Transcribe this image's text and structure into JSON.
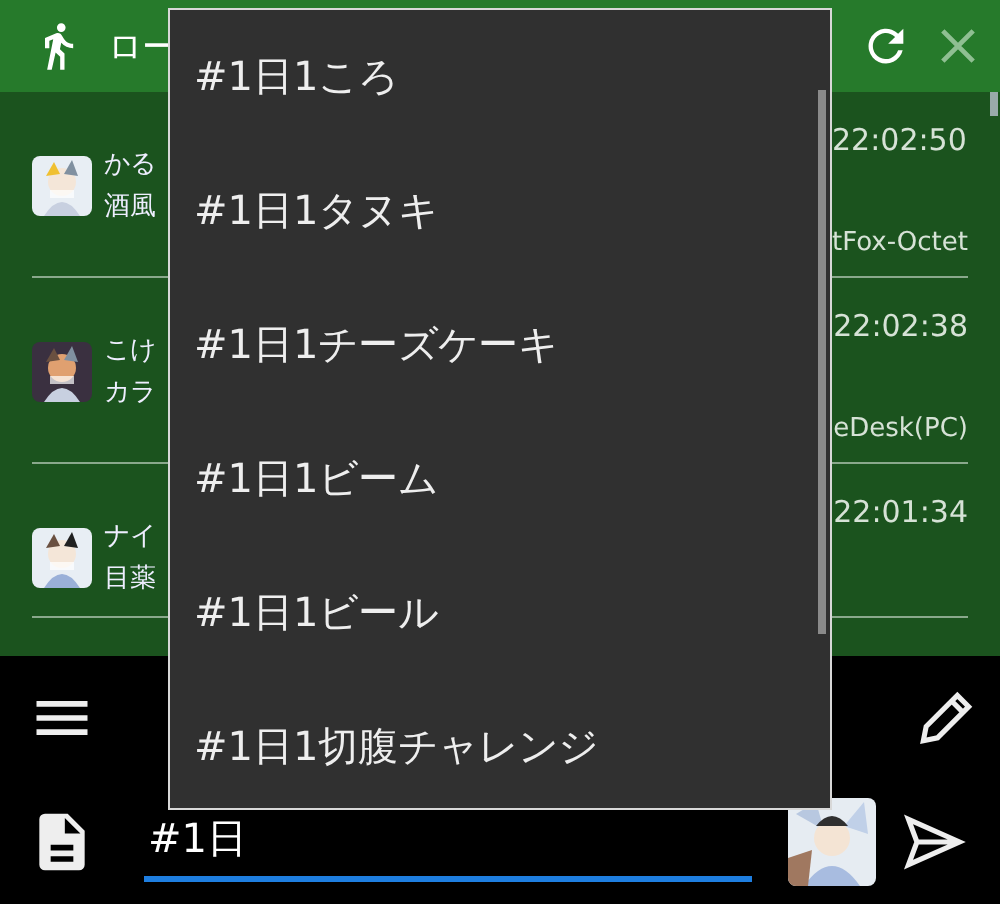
{
  "header": {
    "title": "ロー"
  },
  "timeline": [
    {
      "name": "かる",
      "text": "酒風",
      "time": "22:02:50",
      "source": "tFox-Octet"
    },
    {
      "name": "こけ",
      "text": "カラ",
      "time": "22:02:38",
      "source": "eDesk(PC)"
    },
    {
      "name": "ナイ",
      "text": "目薬",
      "time": "22:01:34"
    }
  ],
  "suggestions": [
    {
      "label": "#1日1ころ"
    },
    {
      "label": "#1日1タヌキ"
    },
    {
      "label": "#1日1チーズケーキ"
    },
    {
      "label": "#1日1ビーム"
    },
    {
      "label": "#1日1ビール"
    },
    {
      "label": "#1日1切腹チャレンジ"
    }
  ],
  "compose": {
    "value": "#1日"
  }
}
